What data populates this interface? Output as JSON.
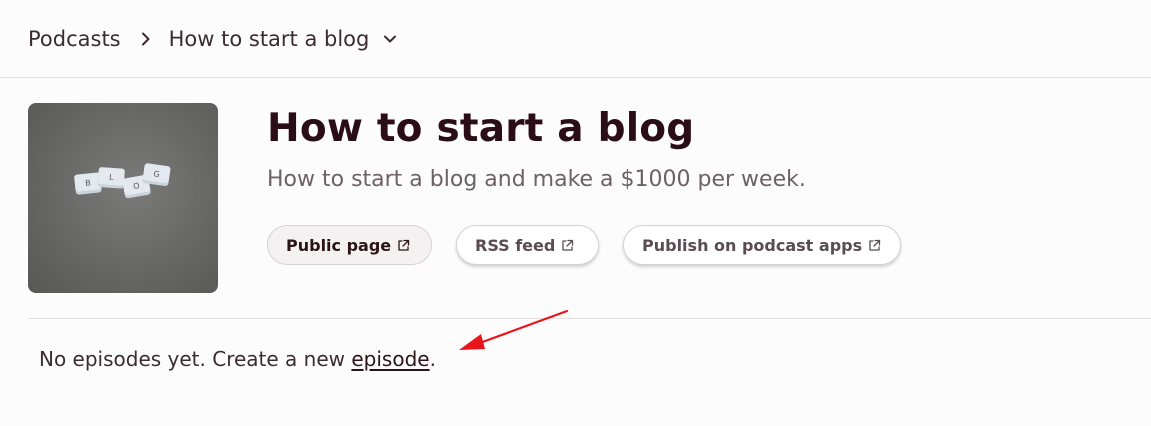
{
  "breadcrumb": {
    "root": "Podcasts",
    "current": "How to start a blog"
  },
  "podcast": {
    "cover_tiles": [
      "B",
      "L",
      "O",
      "G"
    ],
    "title": "How to start a blog",
    "description": "How to start a blog and make a $1000 per week."
  },
  "actions": {
    "public_page": "Public page",
    "rss_feed": "RSS feed",
    "publish_apps": "Publish on podcast apps"
  },
  "episodes": {
    "empty_prefix": "No episodes yet. Create a new ",
    "empty_link": "episode",
    "empty_suffix": "."
  },
  "colors": {
    "title": "#2b0d17",
    "annotation_arrow": "#e8141b"
  },
  "icons": {
    "breadcrumb_separator": "chevron-right-icon",
    "dropdown": "chevron-down-icon",
    "external_link": "external-link-icon"
  }
}
